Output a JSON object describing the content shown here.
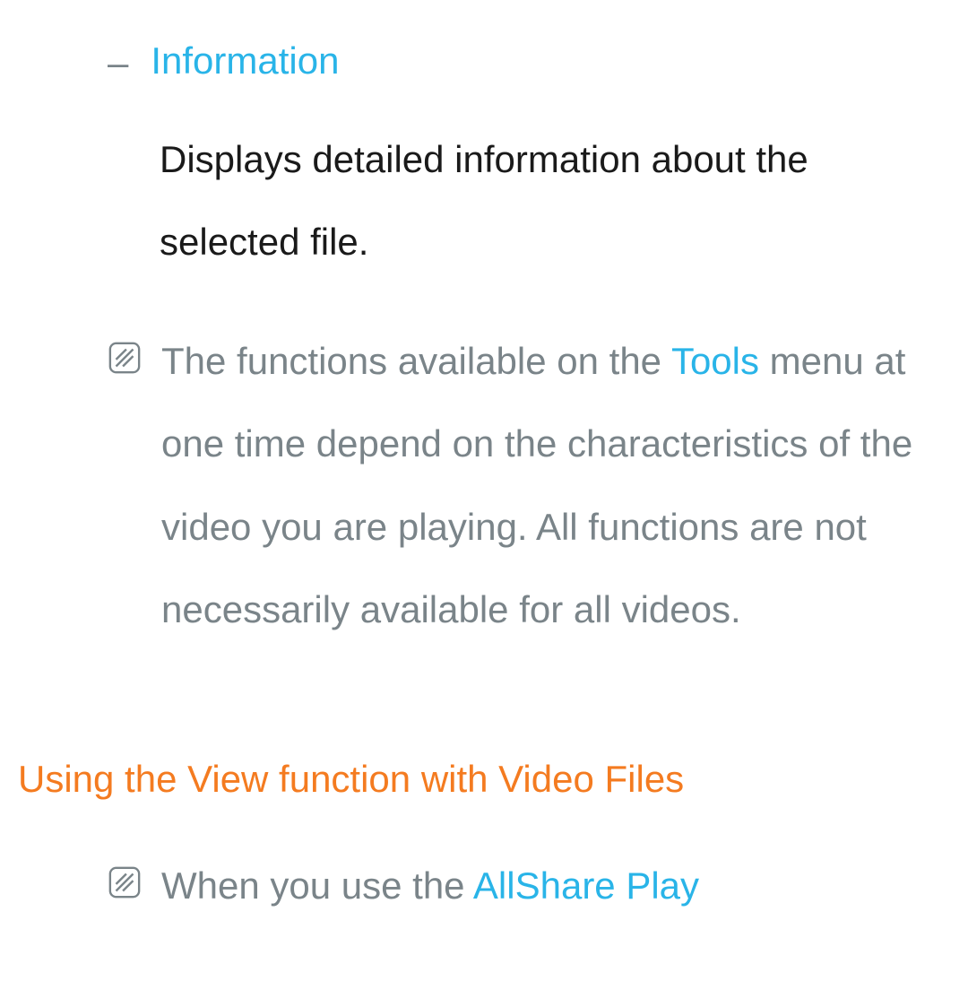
{
  "item": {
    "dash": "–",
    "title": "Information",
    "description": "Displays detailed information about the selected file."
  },
  "note1": {
    "pre": "The functions available on the ",
    "highlight": "Tools",
    "post": " menu at one time depend on the characteristics of the video you are playing. All functions are not necessarily available for all videos."
  },
  "heading": "Using the View function with Video Files",
  "note2": {
    "pre": "When you use the ",
    "highlight": "AllShare Play"
  }
}
